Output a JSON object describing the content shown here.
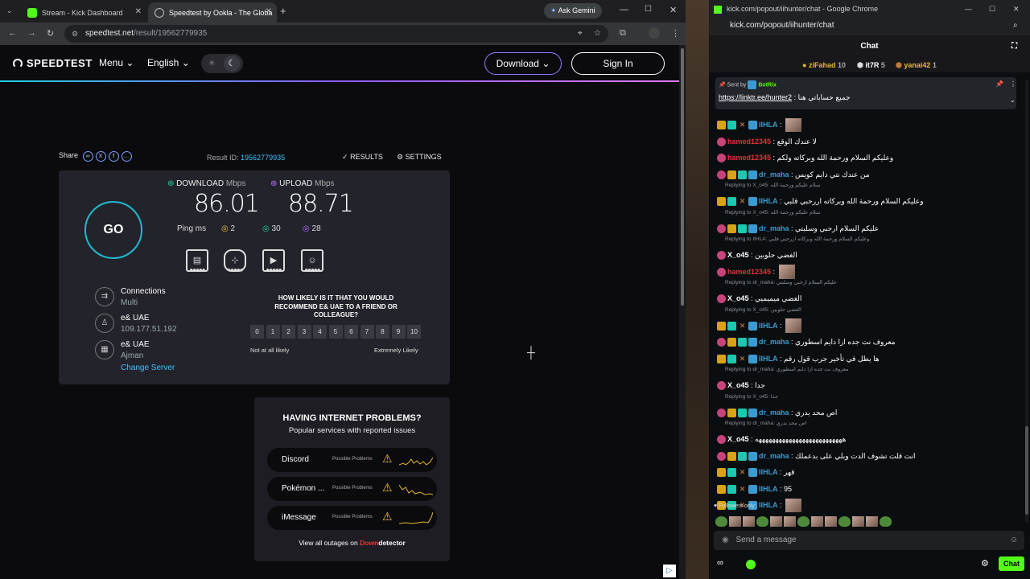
{
  "browser": {
    "tabs": [
      {
        "label": "Stream - Kick Dashboard"
      },
      {
        "label": "Speedtest by Ookla - The Globa"
      }
    ],
    "ask_gemini": "Ask Gemini",
    "url_host": "speedtest.net",
    "url_path": "/result/19562779935"
  },
  "speedtest": {
    "logo": "SPEEDTEST",
    "menu": "Menu",
    "language": "English",
    "download_btn": "Download",
    "signin_btn": "Sign In",
    "share_label": "Share",
    "result_id_label": "Result ID:",
    "result_id": "19562779935",
    "results_label": "RESULTS",
    "settings_label": "SETTINGS",
    "go_label": "GO",
    "download_label": "DOWNLOAD",
    "upload_label": "UPLOAD",
    "unit": "Mbps",
    "download_value": "86.01",
    "upload_value": "88.71",
    "ping_label": "Ping ms",
    "ping_idle": "2",
    "ping_download": "30",
    "ping_upload": "28",
    "connections_label": "Connections",
    "connections_value": "Multi",
    "isp_name": "e& UAE",
    "isp_ip": "109.177.51.192",
    "server_name": "e& UAE",
    "server_city": "Ajman",
    "change_server": "Change Server",
    "question": "HOW LIKELY IS IT THAT YOU WOULD RECOMMEND E& UAE TO A FRIEND OR COLLEAGUE?",
    "scale": [
      "0",
      "1",
      "2",
      "3",
      "4",
      "5",
      "6",
      "7",
      "8",
      "9",
      "10"
    ],
    "scale_low": "Not at all likely",
    "scale_high": "Extremely Likely",
    "problems_title": "HAVING INTERNET PROBLEMS?",
    "problems_sub": "Popular services with reported issues",
    "services": [
      {
        "name": "Discord",
        "status": "Possible Problems"
      },
      {
        "name": "Pokémon ...",
        "status": "Possible Problems"
      },
      {
        "name": "iMessage",
        "status": "Possible Problems"
      }
    ],
    "view_all": "View all outages on",
    "downdetector_down": "Down",
    "downdetector_detector": "detector"
  },
  "kick": {
    "window_title": "kick.com/popout/iihunter/chat - Google Chrome",
    "address": "kick.com/popout/iihunter/chat",
    "chat_title": "Chat",
    "leaderboard": [
      {
        "name": "ziFahad",
        "count": "10"
      },
      {
        "name": "it7R",
        "count": "5"
      },
      {
        "name": "yanai42",
        "count": "1"
      }
    ],
    "pinned_by_label": "Sent by",
    "pinned_by": "BotRix",
    "pinned_link": "https://linktr.ee/hunter2",
    "pinned_text": "جميع حساباتي هنا",
    "messages": [
      {
        "user": "IIHLA",
        "text": "",
        "color": "#3b9bd1"
      },
      {
        "user": "hamed12345",
        "text": "لا عندك الوقع",
        "color": "#e0313c"
      },
      {
        "user": "hamed12345",
        "text": "وعليكم السلام ورحمة الله وبركاته ولكم",
        "color": "#e0313c"
      },
      {
        "user": "dr_maha",
        "text": "من عندك نتي دايم كويس",
        "color": "#3b9bd1"
      },
      {
        "reply": "Replying to X_o45: سلام عليكم ورحمة الله"
      },
      {
        "user": "IIHLA",
        "text": "وعليكم السلام ورحمة الله وبركاته اررحبي قلبي",
        "color": "#3b9bd1"
      },
      {
        "reply": "Replying to X_o45: سلام عليكم ورحمة الله"
      },
      {
        "user": "dr_maha",
        "text": "عليكم السلام ارحبي وسلبتي",
        "color": "#3b9bd1"
      },
      {
        "reply": "Replying to IIHLA: وعليكم السلام ورحمة الله وبركاته اررحبي قلبي"
      },
      {
        "user": "X_o45",
        "text": "الغضي حلوبين",
        "color": "#ffffff"
      },
      {
        "user": "hamed12345",
        "text": "",
        "color": "#e0313c"
      },
      {
        "reply": "Replying to dr_maha: عليكم السلام ارحبي وسلبتي"
      },
      {
        "user": "X_o45",
        "text": "الغضي ميميميي",
        "color": "#ffffff"
      },
      {
        "reply": "Replying to X_o45: الغضي حلوبين"
      },
      {
        "user": "IIHLA",
        "text": "",
        "color": "#3b9bd1"
      },
      {
        "user": "dr_maha",
        "text": "معروف نت جده ازا دايم اسطوري",
        "color": "#3b9bd1"
      },
      {
        "user": "IIHLA",
        "text": "ها يطل في تأخير جرب قول رقم",
        "color": "#3b9bd1"
      },
      {
        "reply": "Replying to dr_maha: معروف نت جده ازا دايم اسطوري"
      },
      {
        "user": "X_o45",
        "text": "جدا",
        "color": "#ffffff"
      },
      {
        "reply": "Replying to X_o45: جدا"
      },
      {
        "user": "dr_maha",
        "text": "اص محد يدري",
        "color": "#3b9bd1"
      },
      {
        "reply": "Replying to dr_maha: اص محد يدري"
      },
      {
        "user": "X_o45",
        "text": "ههههههههههههههههههههههههههه",
        "color": "#ffffff"
      },
      {
        "user": "dr_maha",
        "text": "انت قلت تشوف الدت وبلي على بدعملك",
        "color": "#3b9bd1"
      },
      {
        "user": "IIHLA",
        "text": "قهر",
        "color": "#3b9bd1"
      },
      {
        "user": "IIHLA",
        "text": "95",
        "color": "#3b9bd1"
      },
      {
        "user": "IIHLA",
        "text": "",
        "color": "#3b9bd1"
      }
    ],
    "followers_only": "Followers only",
    "send_placeholder": "Send a message",
    "chat_button": "Chat",
    "accent": "#53fc18"
  }
}
